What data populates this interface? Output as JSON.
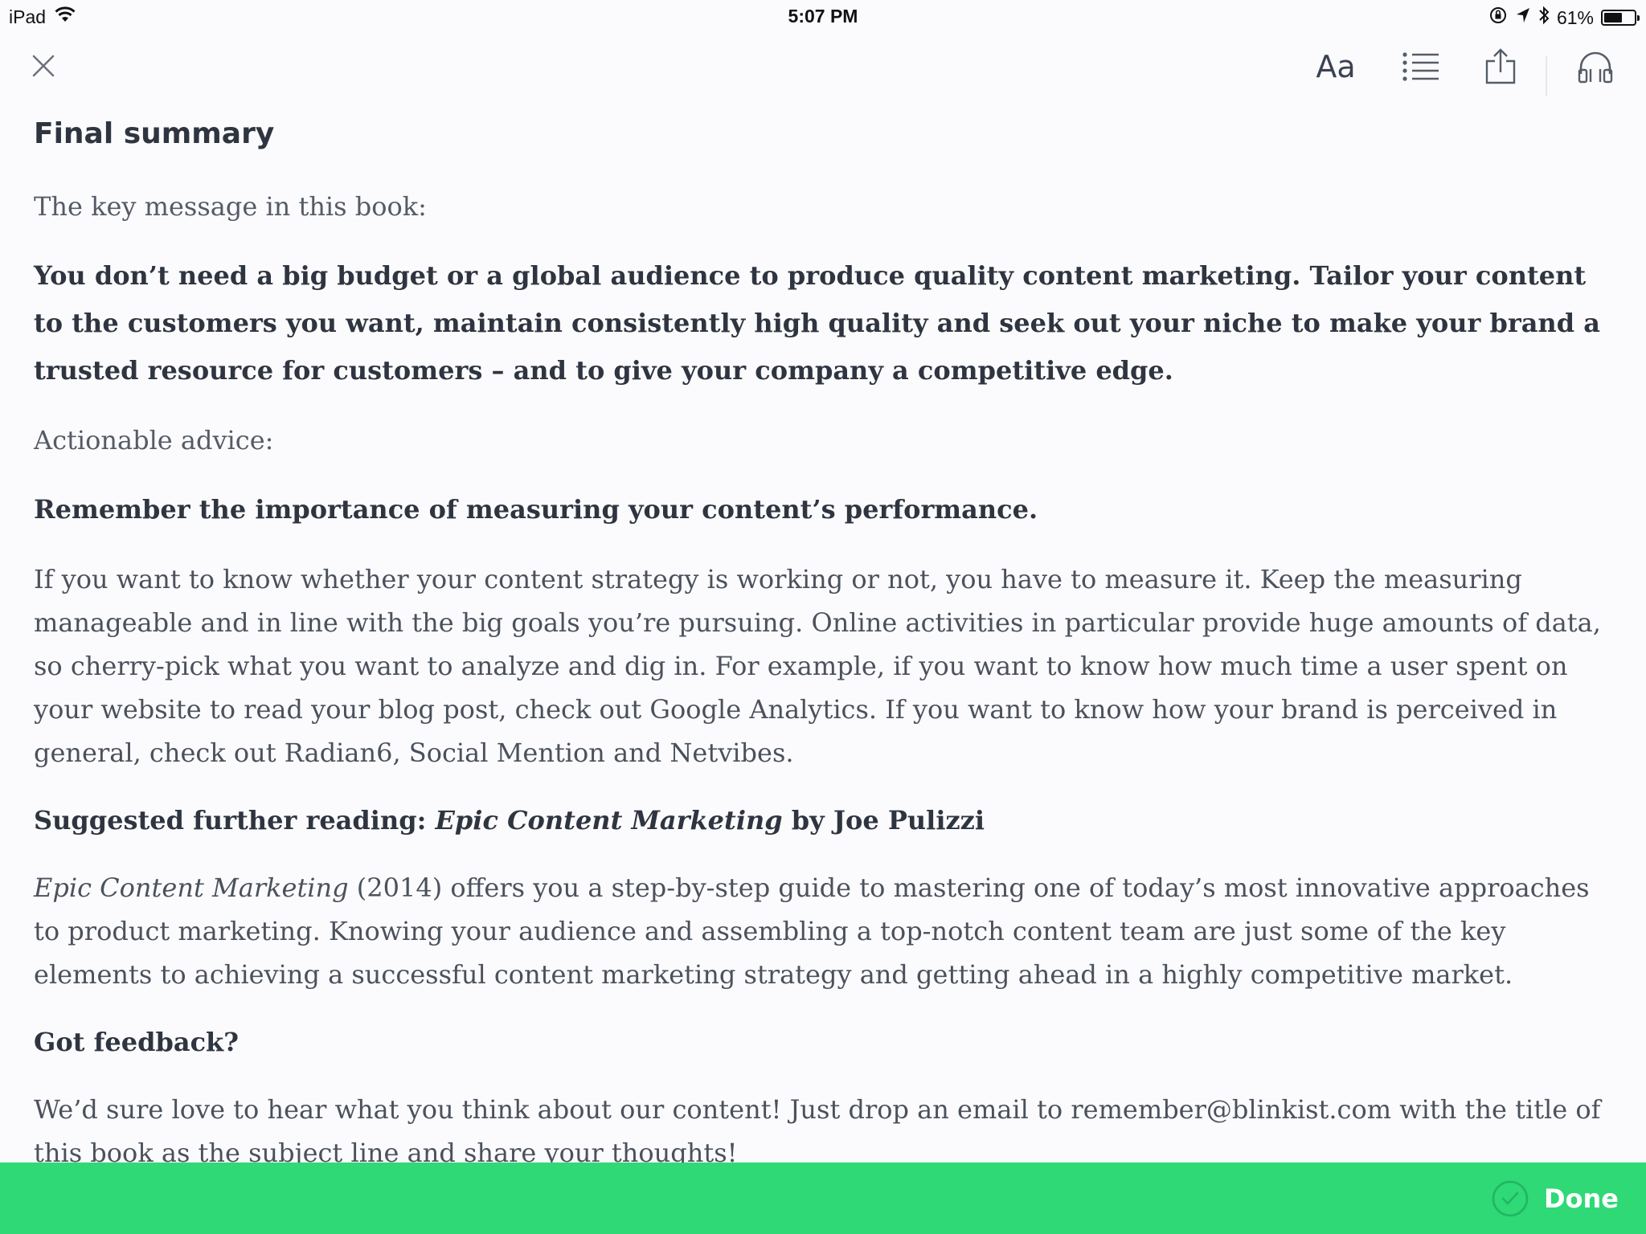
{
  "status_bar": {
    "device": "iPad",
    "time": "5:07 PM",
    "battery": "61%",
    "battery_level": 0.61,
    "icons": [
      "wifi-icon",
      "orientation-lock-icon",
      "location-arrow-icon",
      "bluetooth-icon",
      "battery-icon"
    ]
  },
  "toolbar": {
    "font_label": "Aa",
    "icons": [
      "close-icon",
      "font-settings",
      "table-of-contents-icon",
      "share-icon",
      "headphones-icon"
    ]
  },
  "content": {
    "title": "Final summary",
    "key_message_label": "The key message in this book:",
    "key_message": "You don’t need a big budget or a global audience to produce quality content marketing. Tailor your content to the customers you want, maintain consistently high quality and seek out your niche to make your brand a trusted resource for customers – and to give your company a competitive edge.",
    "advice_label": "Actionable advice:",
    "advice_heading": "Remember the importance of measuring your content’s performance.",
    "advice_body": "If you want to know whether your content strategy is working or not, you have to measure it. Keep the measuring manageable and in line with the big goals you’re pursuing. Online activities in particular provide huge amounts of data, so cherry-pick what you want to analyze and dig in. For example, if you want to know how much time a user spent on your website to read your blog post, check out Google Analytics. If you want to know how your brand is perceived in general, check out Radian6, Social Mention and Netvibes.",
    "reading_prefix": "Suggested further reading: ",
    "reading_title": "Epic Content Marketing",
    "reading_suffix": " by Joe Pulizzi",
    "reading_body_title": "Epic Content Marketing",
    "reading_body": " (2014) offers you a step-by-step guide to mastering one of today’s most innovative approaches to product marketing. Knowing your audience and assembling a top-notch content team are just some of the key elements to achieving a successful content marketing strategy and getting ahead in a highly competitive market.",
    "feedback_heading": "Got feedback?",
    "feedback_body": "We’d sure love to hear what you think about our content! Just drop an email to remember@blinkist.com with the title of this book as the subject line and share your thoughts!"
  },
  "bottom_bar": {
    "done_label": "Done",
    "color": "#2ed976"
  }
}
